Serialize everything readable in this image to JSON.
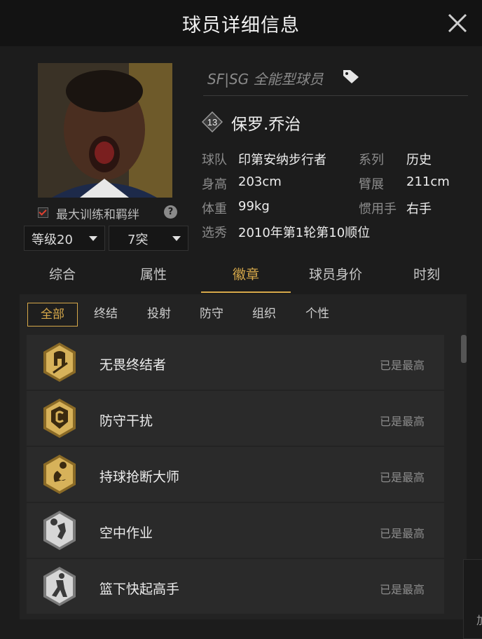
{
  "header": {
    "title": "球员详细信息"
  },
  "player": {
    "position": "SF|SG 全能型球员",
    "number": "13",
    "name": "保罗.乔治",
    "max_training_label": "最大训练和羁绊",
    "level_select": "等级20",
    "break_select": "7突",
    "info": {
      "team_label": "球队",
      "team": "印第安纳步行者",
      "series_label": "系列",
      "series": "历史",
      "height_label": "身高",
      "height": "203cm",
      "wingspan_label": "臂展",
      "wingspan": "211cm",
      "weight_label": "体重",
      "weight": "99kg",
      "hand_label": "惯用手",
      "hand": "右手",
      "draft_label": "选秀",
      "draft": "2010年第1轮第10顺位"
    }
  },
  "tabs": [
    "综合",
    "属性",
    "徽章",
    "球员身价",
    "时刻"
  ],
  "active_tab": "徽章",
  "subtabs": [
    "全部",
    "终结",
    "投射",
    "防守",
    "组织",
    "个性"
  ],
  "active_subtab": "全部",
  "badges": [
    {
      "name": "无畏终结者",
      "status": "已是最高",
      "tier": "gold",
      "icon": "spartan-helmet-icon"
    },
    {
      "name": "防守干扰",
      "status": "已是最高",
      "tier": "gold",
      "icon": "shield-c-icon"
    },
    {
      "name": "持球抢断大师",
      "status": "已是最高",
      "tier": "gold",
      "icon": "steal-icon"
    },
    {
      "name": "空中作业",
      "status": "已是最高",
      "tier": "silver",
      "icon": "alley-oop-icon"
    },
    {
      "name": "篮下快起高手",
      "status": "已是最高",
      "tier": "silver",
      "icon": "putback-icon"
    }
  ],
  "edge_text": "加",
  "colors": {
    "accent": "#d6a84a",
    "gold": "#c9a24a",
    "silver": "#bfbfbf"
  }
}
